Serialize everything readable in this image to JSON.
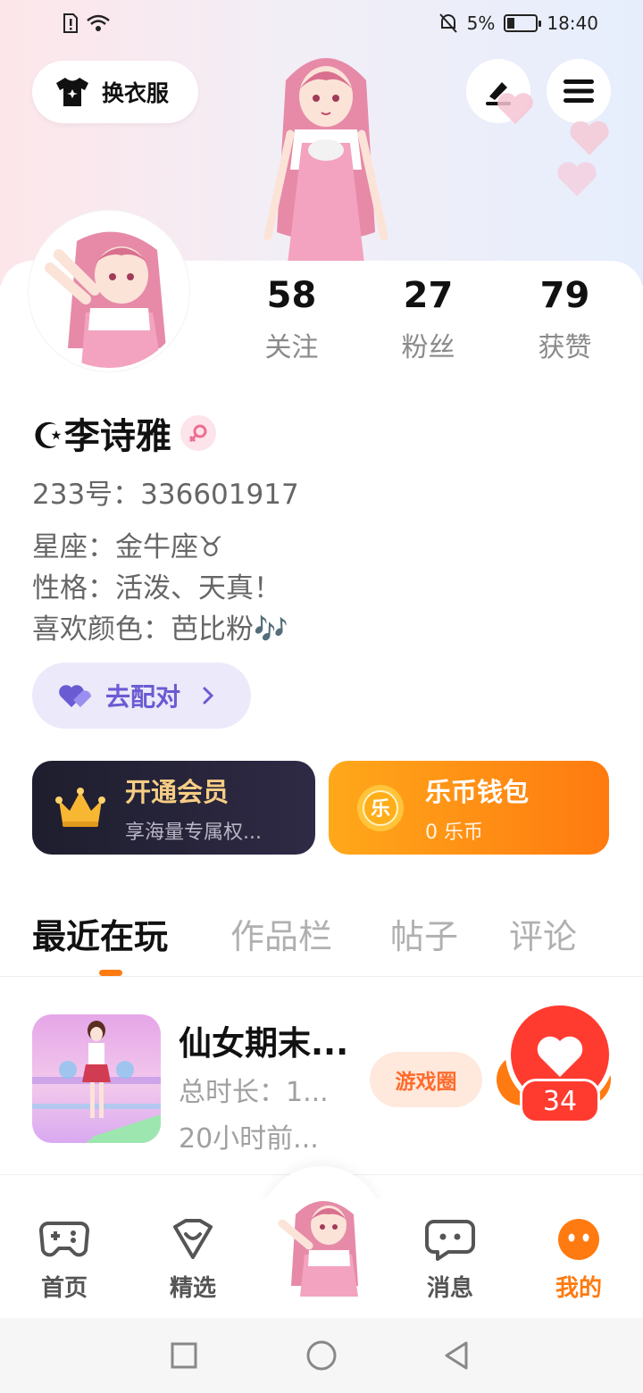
{
  "status_bar": {
    "battery": "5%",
    "time": "18:40"
  },
  "header": {
    "outfit_label": "换衣服"
  },
  "stats": [
    {
      "value": "58",
      "label": "关注"
    },
    {
      "value": "27",
      "label": "粉丝"
    },
    {
      "value": "79",
      "label": "获赞"
    }
  ],
  "profile": {
    "name": "☪李诗雅",
    "uid": "233号：336601917",
    "bio": [
      "星座：金牛座♉",
      "性格：活泼、天真！",
      "喜欢颜色：芭比粉🎶"
    ],
    "match_label": "去配对"
  },
  "cards": {
    "vip_title": "开通会员",
    "vip_sub": "享海量专属权...",
    "wallet_title": "乐币钱包",
    "wallet_sub": "0 乐币",
    "coin_char": "乐"
  },
  "tabs": [
    {
      "label": "最近在玩",
      "active": true
    },
    {
      "label": "作品栏",
      "active": false
    },
    {
      "label": "帖子",
      "active": false
    },
    {
      "label": "评论",
      "active": false
    }
  ],
  "recent_game": {
    "title": "仙女期末...",
    "duration": "总时长：1...",
    "last_played": "20小时前...",
    "circle_label": "游戏圈",
    "likes": "34"
  },
  "bottom_nav": [
    {
      "label": "首页",
      "icon": "gamepad-icon"
    },
    {
      "label": "精选",
      "icon": "heart-badge-icon"
    },
    {
      "label": "消息",
      "icon": "chat-icon"
    },
    {
      "label": "我的",
      "icon": "me-icon",
      "active": true
    }
  ],
  "colors": {
    "accent": "#ff7a10",
    "vip_gold": "#f6cd84",
    "match_purple": "#6a5bd3",
    "like_red": "#ff3b30"
  }
}
